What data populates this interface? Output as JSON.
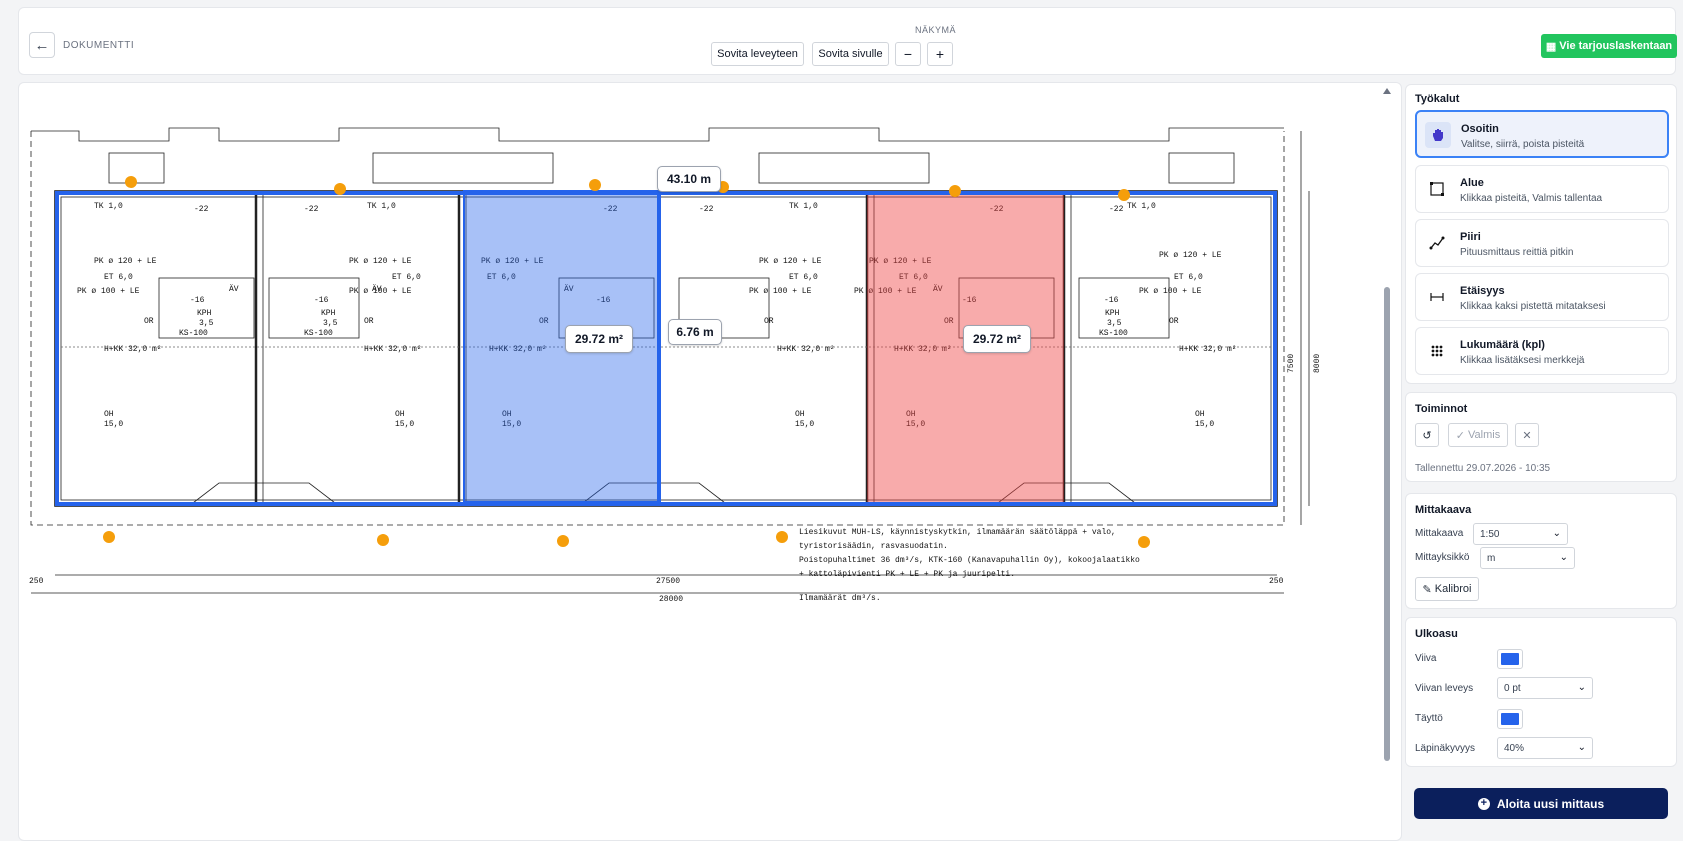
{
  "header": {
    "doc_label": "DOKUMENTTI",
    "view_label": "NÄKYMÄ",
    "fit_width": "Sovita leveyteen",
    "fit_page": "Sovita sivulle",
    "zoom_out": "−",
    "zoom_in": "+",
    "export_label": "Vie tarjouslaskentaan"
  },
  "tools": {
    "title": "Työkalut",
    "items": [
      {
        "name": "Osoitin",
        "desc": "Valitse, siirrä, poista pisteitä",
        "icon": "hand-icon"
      },
      {
        "name": "Alue",
        "desc": "Klikkaa pisteitä, Valmis tallentaa",
        "icon": "area-icon"
      },
      {
        "name": "Piiri",
        "desc": "Pituusmittaus reittiä pitkin",
        "icon": "polyline-icon"
      },
      {
        "name": "Etäisyys",
        "desc": "Klikkaa kaksi pistettä mitataksesi",
        "icon": "distance-icon"
      },
      {
        "name": "Lukumäärä (kpl)",
        "desc": "Klikkaa lisätäksesi merkkejä",
        "icon": "count-grid-icon"
      }
    ]
  },
  "actions": {
    "title": "Toiminnot",
    "done": "Valmis",
    "saved": "Tallennettu 29.07.2026 - 10:35"
  },
  "scale": {
    "title": "Mittakaava",
    "scale_label": "Mittakaava",
    "scale_value": "1:50",
    "unit_label": "Mittayksikkö",
    "unit_value": "m",
    "calibrate": "Kalibroi"
  },
  "appearance": {
    "title": "Ulkoasu",
    "line_label": "Viiva",
    "line_color": "#2563eb",
    "width_label": "Viivan leveys",
    "width_value": "0 pt",
    "fill_label": "Täyttö",
    "fill_color": "#2563eb",
    "opacity_label": "Läpinäkyvyys",
    "opacity_value": "40%"
  },
  "start_button": "Aloita uusi mittaus",
  "measurements": {
    "perimeter": "43.10 m",
    "area_blue": "29.72 m²",
    "distance": "6.76 m",
    "area_red": "29.72 m²"
  },
  "plan": {
    "room_label": "H+KK 32,0 m²",
    "oh": "OH",
    "oh_val": "15,0",
    "tk": "TK 1,0",
    "pk1": "PK ø 120 + LE",
    "pk2": "PK ø 100 + LE",
    "et": "ET 6,0",
    "kph": "KPH",
    "kph_val": "3,5",
    "ks": "KS-100",
    "or": "OR",
    "av": "ÄV",
    "m22": "-22",
    "m16": "-16",
    "notes": [
      "Liesikuvut MUH-LS, käynnistyskytkin, ilmamäärän säätöläppä + valo,",
      "tyristorisäädin, rasvasuodatin.",
      "Poistopuhaltimet 36 dm³/s, KTK-160 (Kanavapuhallin Oy), kokoojalaatikko",
      "+ kattoläpivienti PK + LE + PK ja juuripelti.",
      "Ilmamäärät dm³/s."
    ],
    "dim_total": "28000",
    "dim_inner": "27500",
    "dim_side": "250",
    "dim_height": "8000",
    "dim_inner_h": "7500"
  }
}
